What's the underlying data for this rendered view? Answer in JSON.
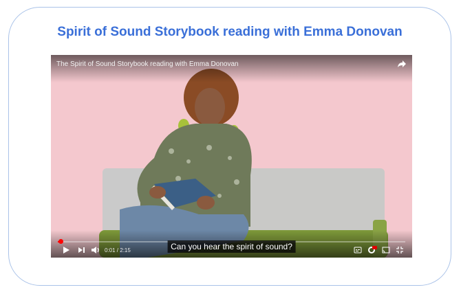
{
  "card": {
    "title": "Spirit of Sound Storybook reading with Emma Donovan"
  },
  "player": {
    "video_title": "The Spirit of Sound Storybook reading with Emma Donovan",
    "caption": "Can you hear the spirit of sound?",
    "time_display": "0:01 / 2:15",
    "progress_fraction": 0.008,
    "icons": {
      "share": "share-icon",
      "play": "play-icon",
      "next": "next-icon",
      "volume": "volume-icon",
      "subtitles": "subtitles-icon",
      "settings": "settings-icon",
      "cast": "cast-icon",
      "fullscreen": "exit-fullscreen-icon"
    },
    "colors": {
      "progress": "#ff0000",
      "title": "#3a6fd8",
      "border": "#a9c2e8"
    }
  }
}
